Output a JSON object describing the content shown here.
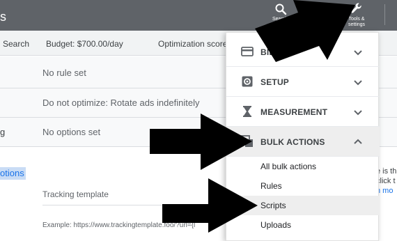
{
  "topbar": {
    "title_fragment": "s",
    "search_label": "Search",
    "tools_label_line1": "Tools &",
    "tools_label_line2": "settings"
  },
  "summary": {
    "search_fragment": "Search",
    "budget": "Budget: $700.00/day",
    "optimization": "Optimization score"
  },
  "rows": [
    {
      "label_fragment": "",
      "value": "No rule set"
    },
    {
      "label_fragment": "",
      "value": "Do not optimize: Rotate ads indefinitely"
    },
    {
      "label_fragment": "g",
      "value": "No options set"
    }
  ],
  "lower": {
    "options_fragment": "otions",
    "tracking_label": "Tracking template",
    "example": "Example: https://www.trackingtemplate.foo/?url={l",
    "side_line1": "e is th",
    "side_line2": "click t",
    "side_line3": "n mo"
  },
  "menu": {
    "sections": [
      {
        "label": "BILLING",
        "icon": "credit-card-icon",
        "expanded": false
      },
      {
        "label": "SETUP",
        "icon": "gear-icon",
        "expanded": false
      },
      {
        "label": "MEASUREMENT",
        "icon": "hourglass-icon",
        "expanded": false
      },
      {
        "label": "BULK ACTIONS",
        "icon": "copy-stack-icon",
        "expanded": true
      }
    ],
    "bulk_items": [
      "All bulk actions",
      "Rules",
      "Scripts",
      "Uploads"
    ],
    "highlighted_item": "Scripts"
  },
  "colors": {
    "topbar": "#5f6368",
    "accent": "#1a73e8",
    "highlight": "#c9dcf5",
    "arrow": "#000000"
  }
}
